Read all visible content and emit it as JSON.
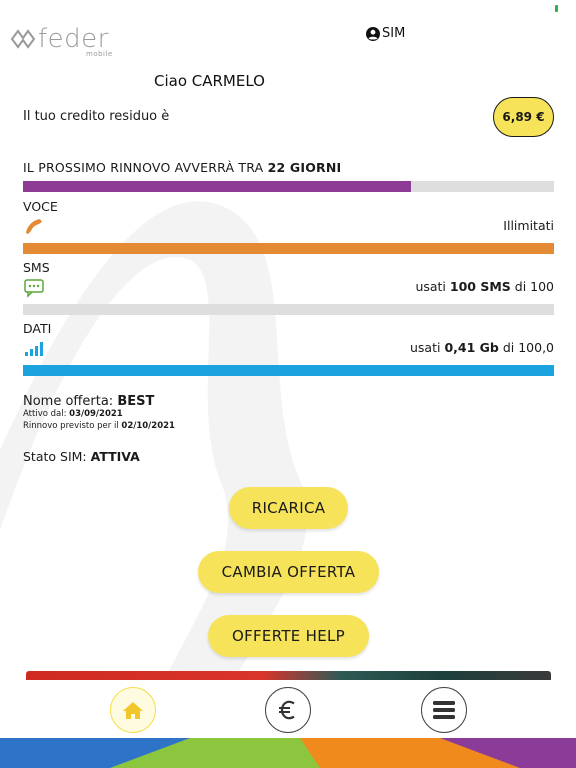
{
  "app": {
    "logo_text": "feder",
    "logo_subtext": "mobile",
    "sim_label": "SIM"
  },
  "greeting": "Ciao CARMELO",
  "credit": {
    "label": "Il tuo credito residuo è",
    "value": "6,89 €"
  },
  "renewal": {
    "prefix": "IL PROSSIMO RINNOVO AVVERRÀ TRA ",
    "days": "22 GIORNI",
    "progress": 0.73,
    "color": "#8e3b96"
  },
  "voce": {
    "label": "VOCE",
    "value": "Illimitati",
    "progress": 1.0,
    "color": "#e38a35",
    "icon": "phone-icon"
  },
  "sms": {
    "label": "SMS",
    "value_prefix": "usati ",
    "value_bold": "100 SMS",
    "value_suffix": " di 100",
    "progress": 0.0,
    "color": "#5aa63a",
    "icon": "sms-icon"
  },
  "dati": {
    "label": "DATI",
    "value_prefix": "usati ",
    "value_bold": "0,41 Gb",
    "value_suffix": " di 100,0",
    "progress": 1.0,
    "color": "#1aa3de",
    "icon": "signal-icon"
  },
  "offer": {
    "label": "Nome offerta: ",
    "name": "BEST",
    "active_label": "Attivo dal: ",
    "active_date": "03/09/2021",
    "renewal_label": "Rinnovo previsto per il ",
    "renewal_date": "02/10/2021"
  },
  "sim_state": {
    "label": "Stato SIM: ",
    "value": "ATTIVA"
  },
  "buttons": {
    "recharge": "RICARICA",
    "change_offer": "CAMBIA OFFERTA",
    "help_offers": "OFFERTE HELP"
  },
  "tabbar": {
    "home_icon": "home-icon",
    "euro_icon": "euro-icon",
    "menu_icon": "menu-icon"
  },
  "colors": {
    "accent_yellow": "#f6e35a",
    "purple": "#8e3b96",
    "orange": "#e38a35",
    "green": "#5aa63a",
    "blue": "#1aa3de"
  }
}
